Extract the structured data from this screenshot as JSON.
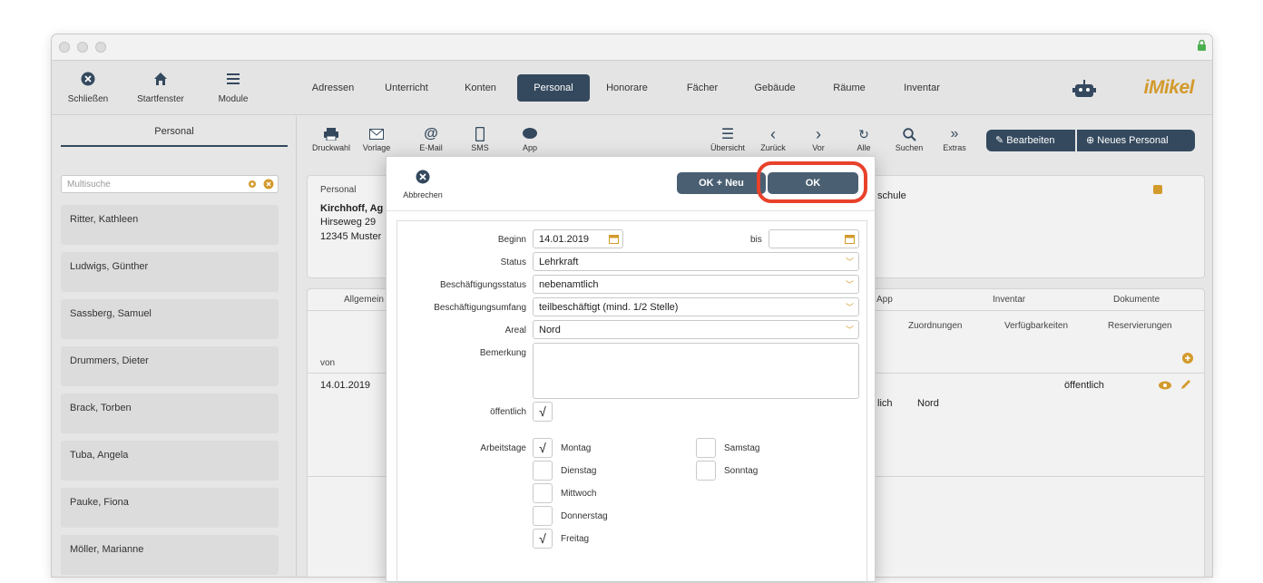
{
  "nav": {
    "buttons": [
      {
        "label": "Schließen",
        "icon": "close-icon"
      },
      {
        "label": "Startfenster",
        "icon": "home-icon"
      },
      {
        "label": "Module",
        "icon": "menu-icon"
      }
    ],
    "tabs": [
      "Adressen",
      "Unterricht",
      "Konten",
      "Personal",
      "Honorare",
      "Fächer",
      "Gebäude",
      "Räume",
      "Inventar"
    ],
    "active_tab": "Personal",
    "logo": "iMikel"
  },
  "sidebar": {
    "title": "Personal",
    "search_placeholder": "Multisuche",
    "people": [
      "Ritter, Kathleen",
      "Ludwigs, Günther",
      "Sassberg, Samuel",
      "Drummers, Dieter",
      "Brack, Torben",
      "Tuba, Angela",
      "Pauke, Fiona",
      "Möller, Marianne"
    ]
  },
  "toolbar": {
    "left": [
      "Druckwahl",
      "Vorlage",
      "E-Mail",
      "SMS",
      "App"
    ],
    "right": [
      "Übersicht",
      "Zurück",
      "Vor",
      "Alle",
      "Suchen",
      "Extras"
    ],
    "edit_label": "Bearbeiten",
    "new_label": "Neues Personal"
  },
  "detail": {
    "section_label": "Personal",
    "name": "Kirchhoff, Ag",
    "street": "Hirseweg 29",
    "city": "12345 Muster",
    "extra": "schule",
    "tabs": [
      "Allgemein",
      "App",
      "Inventar",
      "Dokumente"
    ],
    "subtabs": [
      "Zuordnungen",
      "Verfügbarkeiten",
      "Reservierungen"
    ],
    "col_von": "von",
    "row_date": "14.01.2019",
    "row_public": "öffentlich",
    "row_extra1": "lich",
    "row_extra2": "Nord"
  },
  "modal": {
    "cancel_label": "Abbrechen",
    "ok_new_label": "OK + Neu",
    "ok_label": "OK",
    "fields": {
      "beginn_label": "Beginn",
      "beginn_value": "14.01.2019",
      "bis_label": "bis",
      "bis_value": "",
      "status_label": "Status",
      "status_value": "Lehrkraft",
      "beschaeftigungsstatus_label": "Beschäftigungsstatus",
      "beschaeftigungsstatus_value": "nebenamtlich",
      "umfang_label": "Beschäftigungsumfang",
      "umfang_value": "teilbeschäftigt (mind. 1/2 Stelle)",
      "areal_label": "Areal",
      "areal_value": "Nord",
      "bemerkung_label": "Bemerkung",
      "bemerkung_value": "",
      "oeffentlich_label": "öffentlich",
      "oeffentlich_checked": true,
      "arbeitstage_label": "Arbeitstage"
    },
    "days": [
      {
        "name": "Montag",
        "checked": true
      },
      {
        "name": "Dienstag",
        "checked": false
      },
      {
        "name": "Mittwoch",
        "checked": false
      },
      {
        "name": "Donnerstag",
        "checked": false
      },
      {
        "name": "Freitag",
        "checked": true
      },
      {
        "name": "Samstag",
        "checked": false
      },
      {
        "name": "Sonntag",
        "checked": false
      }
    ],
    "check_mark": "√"
  },
  "colors": {
    "accent": "#34495e",
    "button": "#4a5f72",
    "highlight": "#e8422b",
    "icon_orange": "#d39a2c"
  }
}
